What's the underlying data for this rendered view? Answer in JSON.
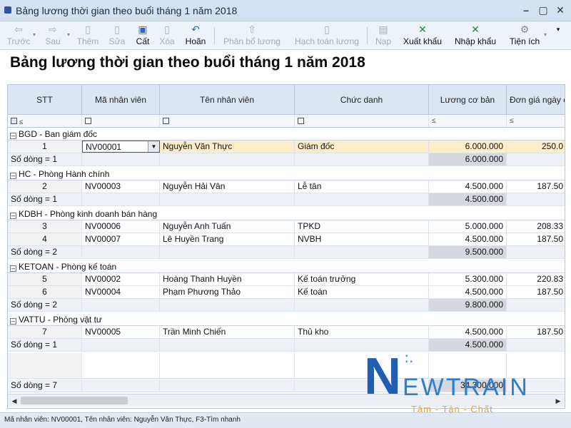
{
  "window": {
    "title": "Bảng lương thời gian theo buổi tháng 1 năm 2018"
  },
  "toolbar": {
    "back": "Trước",
    "next": "Sau",
    "add": "Thêm",
    "edit": "Sửa",
    "save": "Cất",
    "delete": "Xóa",
    "undo": "Hoãn",
    "allocate": "Phân bổ lương",
    "account": "Hạch toán lương",
    "load": "Nạp",
    "export": "Xuất khẩu",
    "import": "Nhập khẩu",
    "utility": "Tiện ích"
  },
  "report": {
    "title": "Bảng lương thời gian theo buổi tháng 1 năm 2018"
  },
  "columns": [
    "STT",
    "Mã nhân viên",
    "Tên nhân viên",
    "Chức danh",
    "Lương cơ bản",
    "Đơn giá ngày c"
  ],
  "filter": {
    "op": "≤"
  },
  "groups": [
    {
      "name": "BGD - Ban giám đốc",
      "rows": [
        {
          "stt": "1",
          "code": "NV00001",
          "name": "Nguyễn Văn Thực",
          "title": "Giám đốc",
          "salary": "6.000.000",
          "rate": "250.0"
        }
      ],
      "count": "Số dòng = 1",
      "total": "6.000.000"
    },
    {
      "name": "HC - Phòng Hành chính",
      "rows": [
        {
          "stt": "2",
          "code": "NV00003",
          "name": "Nguyễn Hải Vân",
          "title": "Lễ tân",
          "salary": "4.500.000",
          "rate": "187.50"
        }
      ],
      "count": "Số dòng = 1",
      "total": "4.500.000"
    },
    {
      "name": "KDBH - Phòng kinh doanh bán hàng",
      "rows": [
        {
          "stt": "3",
          "code": "NV00006",
          "name": "Nguyễn Anh Tuấn",
          "title": "TPKD",
          "salary": "5.000.000",
          "rate": "208.33"
        },
        {
          "stt": "4",
          "code": "NV00007",
          "name": "Lê Huyền Trang",
          "title": "NVBH",
          "salary": "4.500.000",
          "rate": "187.50"
        }
      ],
      "count": "Số dòng = 2",
      "total": "9.500.000"
    },
    {
      "name": "KETOAN - Phòng kế toán",
      "rows": [
        {
          "stt": "5",
          "code": "NV00002",
          "name": "Hoàng Thanh Huyền",
          "title": "Kế toán trưởng",
          "salary": "5.300.000",
          "rate": "220.83"
        },
        {
          "stt": "6",
          "code": "NV00004",
          "name": "Phạm Phương Thảo",
          "title": "Kế toán",
          "salary": "4.500.000",
          "rate": "187.50"
        }
      ],
      "count": "Số dòng = 2",
      "total": "9.800.000"
    },
    {
      "name": "VATTU - Phòng vật tư",
      "rows": [
        {
          "stt": "7",
          "code": "NV00005",
          "name": "Trần Minh Chiến",
          "title": "Thủ kho",
          "salary": "4.500.000",
          "rate": "187.50"
        }
      ],
      "count": "Số dòng = 1",
      "total": "4.500.000"
    }
  ],
  "grand": {
    "count": "Số dòng = 7",
    "total": "34.300.000"
  },
  "status": {
    "text": "Mã nhân viên: NV00001, Tên nhân viên: Nguyễn Văn Thực, F3-Tìm nhanh"
  },
  "watermark": {
    "brand_n": "N",
    "brand_rest": "EWTRAIN",
    "tagline": "Tâm - Tận - Chất"
  }
}
